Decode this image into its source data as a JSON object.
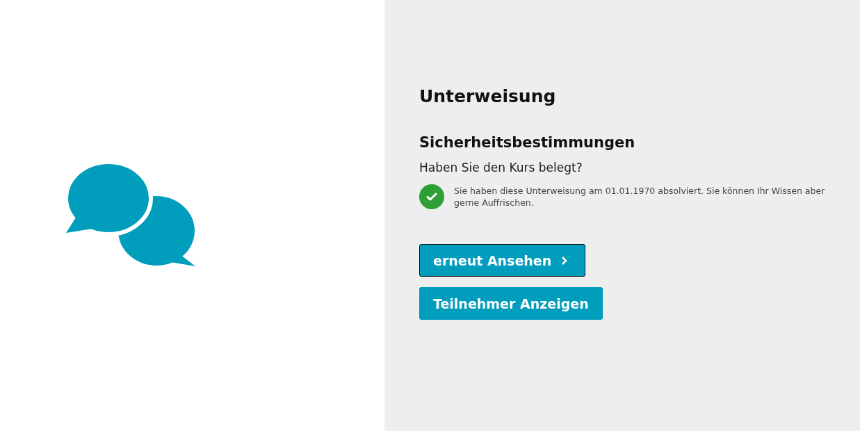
{
  "title": "Unterweisung",
  "course": {
    "name": "Sicherheitsbestimmungen",
    "question": "Haben Sie den Kurs belegt?",
    "completed": true,
    "message": "Sie haben diese Unterweisung am 01.01.1970 absolviert. Sie können Ihr Wissen aber gerne Auffrischen."
  },
  "buttons": [
    {
      "label": "erneut Ansehen",
      "chevron": true,
      "focused": true
    },
    {
      "label": "Teilnehmer Anzeigen",
      "chevron": false,
      "focused": false
    }
  ]
}
